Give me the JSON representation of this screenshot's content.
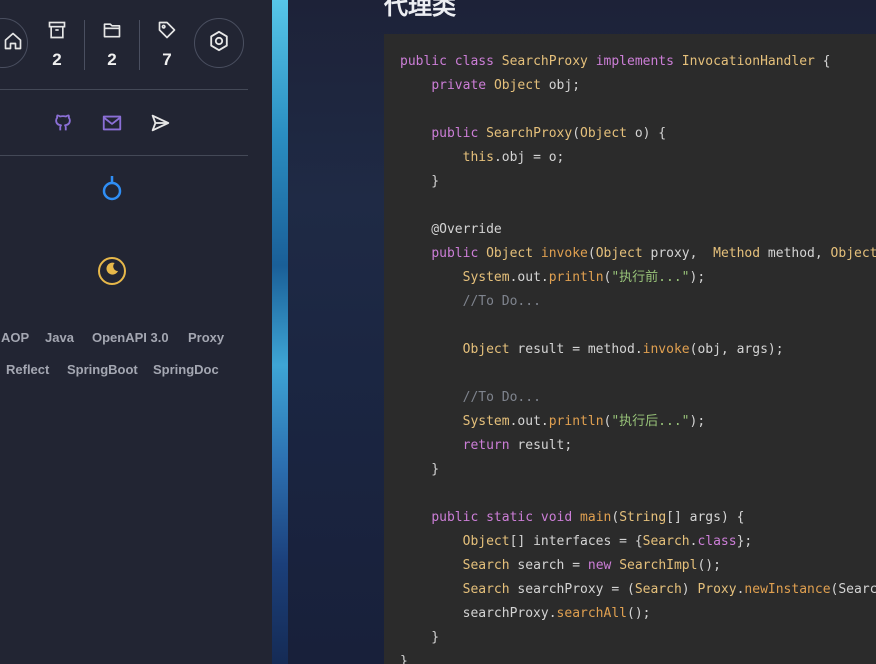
{
  "sidebar": {
    "stats": [
      {
        "name": "archives",
        "icon": "archive-icon",
        "count": "2"
      },
      {
        "name": "categories",
        "icon": "folder-icon",
        "count": "2"
      },
      {
        "name": "tags",
        "icon": "tag-icon",
        "count": "7"
      }
    ],
    "home_icon": "home-icon",
    "settings_icon": "settings-icon",
    "socials": [
      "github-icon",
      "mail-icon",
      "send-icon"
    ],
    "tags": [
      "AOP",
      "Java",
      "OpenAPI 3.0",
      "Proxy",
      "Reflect",
      "SpringBoot",
      "SpringDoc"
    ]
  },
  "article": {
    "heading": "代理类",
    "code_lines": [
      "public class SearchProxy implements InvocationHandler {",
      "    private Object obj;",
      "",
      "    public SearchProxy(Object o) {",
      "        this.obj = o;",
      "    }",
      "",
      "    @Override",
      "    public Object invoke(Object proxy,  Method method, Object[]",
      "        System.out.println(\"执行前...\");",
      "        //To Do...",
      "",
      "        Object result = method.invoke(obj, args);",
      "",
      "        //To Do...",
      "        System.out.println(\"执行后...\");",
      "        return result;",
      "    }",
      "",
      "    public static void main(String[] args) {",
      "        Object[] interfaces = {Search.class};",
      "        Search search = new SearchImpl();",
      "        Search searchProxy = (Search) Proxy.newInstance(SearchPr",
      "        searchProxy.searchAll();",
      "    }",
      "}"
    ]
  },
  "colors": {
    "accent_blue": "#2f8ef5",
    "moon_yellow": "#e7b84a",
    "social_purple": "#8b6fd6",
    "code_bg": "#2b2b2b"
  }
}
